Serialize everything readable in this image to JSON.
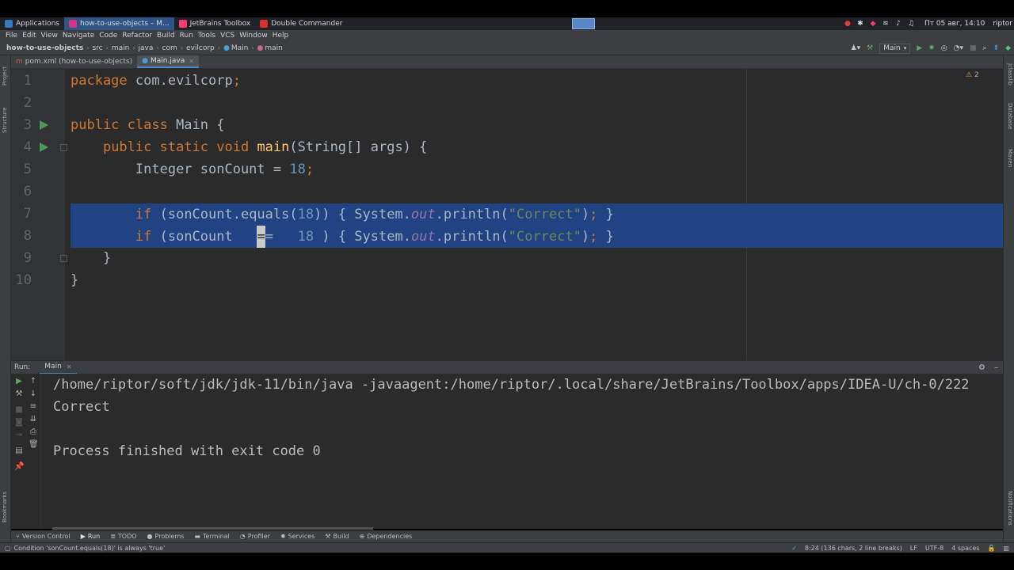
{
  "taskbar": {
    "items": [
      {
        "label": "Applications",
        "active": false,
        "color": "#3a78c4"
      },
      {
        "label": "how-to-use-objects – M...",
        "active": true,
        "color": "#d63384"
      },
      {
        "label": "JetBrains Toolbox",
        "active": false,
        "color": "#ff3d6e"
      },
      {
        "label": "Double Commander",
        "active": false,
        "color": "#d9302c"
      }
    ],
    "datetime": "Пт 05 авг, 14:10",
    "user": "riptor"
  },
  "menu": [
    "File",
    "Edit",
    "View",
    "Navigate",
    "Code",
    "Refactor",
    "Build",
    "Run",
    "Tools",
    "VCS",
    "Window",
    "Help"
  ],
  "breadcrumb": [
    "how-to-use-objects",
    "src",
    "main",
    "java",
    "com",
    "evilcorp",
    "Main",
    "main"
  ],
  "run_config": "Main",
  "tabs": [
    {
      "label": "pom.xml (how-to-use-objects)",
      "active": false
    },
    {
      "label": "Main.java",
      "active": true
    }
  ],
  "left_strip": [
    "Project",
    "Structure",
    "Bookmarks"
  ],
  "right_strip": [
    "Jclasslib",
    "Database",
    "Maven",
    "Notifications"
  ],
  "editor": {
    "warning_count": "2",
    "line_numbers": [
      "1",
      "2",
      "3",
      "4",
      "5",
      "6",
      "7",
      "8",
      "9",
      "10"
    ],
    "lines": {
      "l1": {
        "kw": "package",
        "rest": " com.evilcorp",
        "semi": ";"
      },
      "l3": {
        "kw": "public class",
        "rest": " Main {"
      },
      "l4": {
        "kw": "public static void",
        "fn": "main",
        "rest": "(String[] args) {"
      },
      "l5": {
        "pre": "Integer sonCount = ",
        "num": "18",
        "semi": ";"
      },
      "l7": {
        "kw": "if",
        "a": " (sonCount.equals(",
        "num": "18",
        "b": ")) { System.",
        "out": "out",
        "c": ".println(",
        "str": "\"Correct\"",
        "semi": ";",
        "d": " }"
      },
      "l8": {
        "kw": "if",
        "a": " (sonCount   ",
        "caret": "=",
        "a2": "=   ",
        "num": "18",
        "b": " ) { System.",
        "out": "out",
        "c": ".println(",
        "str": "\"Correct\"",
        "semi": ";",
        "d": " }"
      },
      "l9": {
        "rest": "}"
      },
      "l10": {
        "rest": "}"
      }
    }
  },
  "run": {
    "label": "Run:",
    "tab": "Main",
    "console": [
      "/home/riptor/soft/jdk/jdk-11/bin/java -javaagent:/home/riptor/.local/share/JetBrains/Toolbox/apps/IDEA-U/ch-0/222",
      "Correct",
      "",
      "Process finished with exit code 0"
    ]
  },
  "tool_windows": [
    "Version Control",
    "Run",
    "TODO",
    "Problems",
    "Terminal",
    "Profiler",
    "Services",
    "Build",
    "Dependencies"
  ],
  "status": {
    "message": "Condition 'sonCount.equals(18)' is always 'true'",
    "position": "8:24 (136 chars, 2 line breaks)",
    "line_sep": "LF",
    "encoding": "UTF-8",
    "indent": "4 spaces"
  }
}
